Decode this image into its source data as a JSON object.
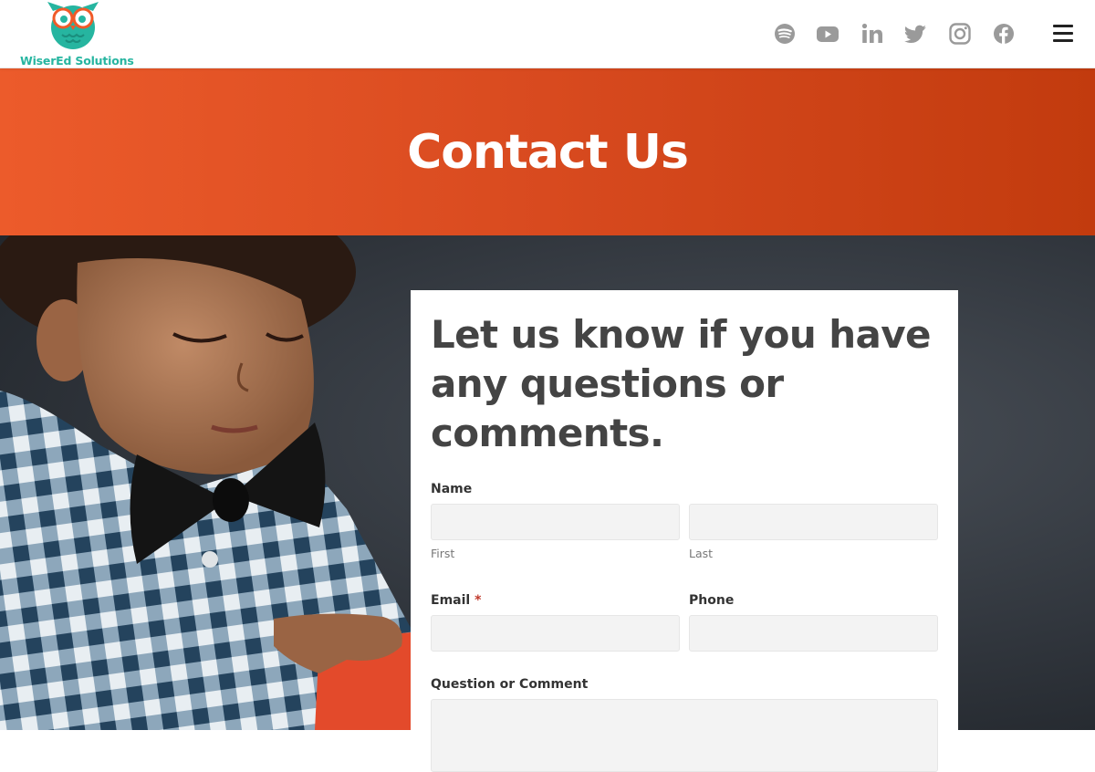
{
  "header": {
    "logo_text": "WiserEd Solutions",
    "social": [
      {
        "name": "spotify-icon"
      },
      {
        "name": "youtube-icon"
      },
      {
        "name": "linkedin-icon"
      },
      {
        "name": "twitter-icon"
      },
      {
        "name": "instagram-icon"
      },
      {
        "name": "facebook-icon"
      }
    ],
    "menu_icon": "hamburger-menu-icon"
  },
  "banner": {
    "title": "Contact Us"
  },
  "form": {
    "heading": "Let us know if you have any questions or comments.",
    "name_label": "Name",
    "first_sublabel": "First",
    "last_sublabel": "Last",
    "first_value": "",
    "last_value": "",
    "email_label": "Email",
    "email_required_marker": "*",
    "email_value": "",
    "phone_label": "Phone",
    "phone_value": "",
    "comment_label": "Question or Comment",
    "comment_value": ""
  },
  "colors": {
    "brand_teal": "#26b5a0",
    "banner_orange_start": "#ec5b2b",
    "banner_orange_end": "#c23b0e",
    "required_red": "#c0392b",
    "social_icon_gray": "#9a9a9a"
  }
}
